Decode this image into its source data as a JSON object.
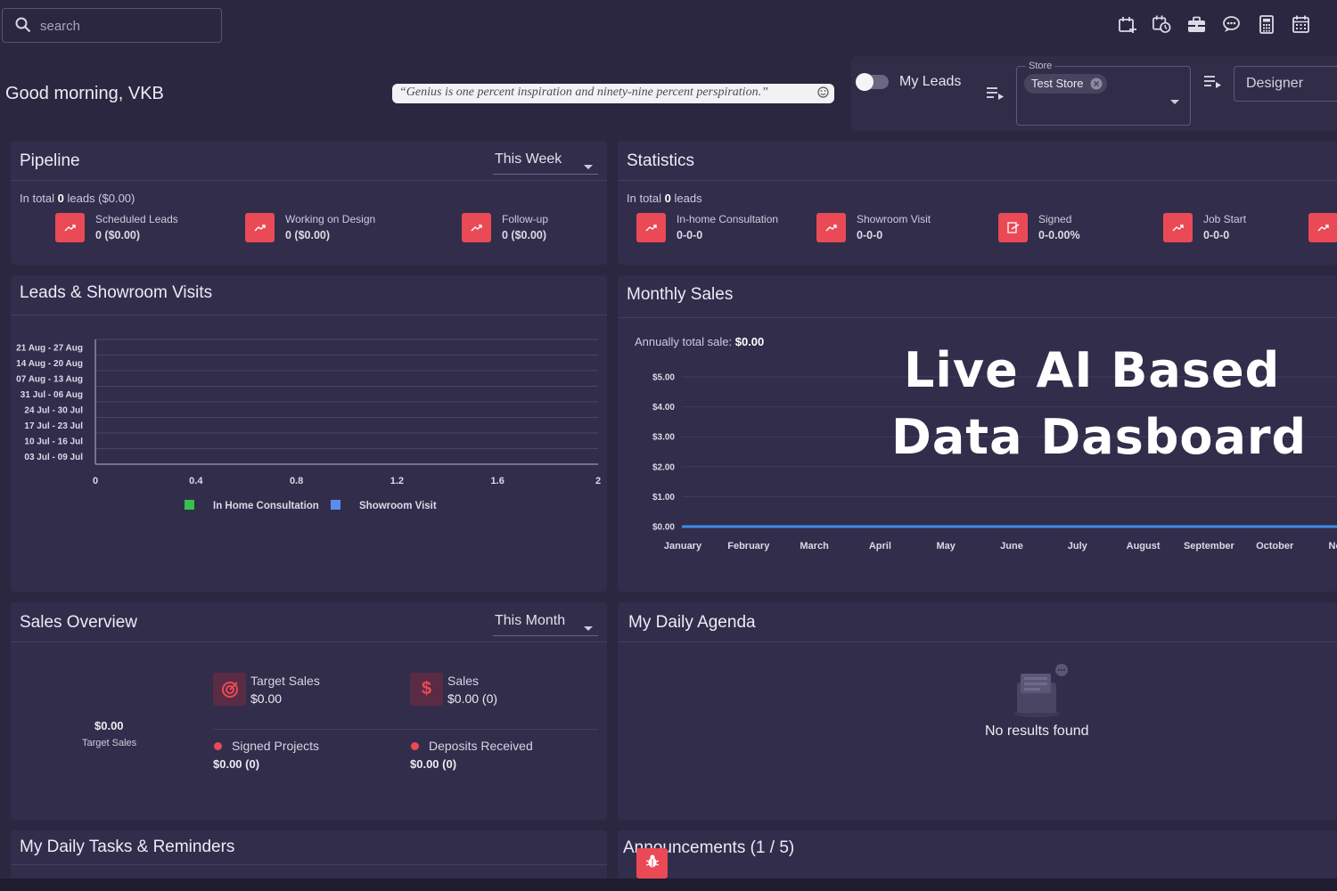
{
  "search": {
    "placeholder": "search"
  },
  "toolbar_icons": [
    "add-calendar-icon",
    "schedule-icon",
    "briefcase-icon",
    "chat-bubble-icon",
    "calculator-icon",
    "calendar-icon"
  ],
  "header": {
    "greeting": "Good morning, VKB",
    "quote": "“Genius is one percent inspiration and ninety-nine percent perspiration.”"
  },
  "filters": {
    "my_leads_label": "My Leads",
    "my_leads_on": false,
    "store_label": "Store",
    "store_chip": "Test Store",
    "role_value": "Designer"
  },
  "pipeline": {
    "title": "Pipeline",
    "period": "This Week",
    "total_prefix": "In total ",
    "total_count": "0",
    "total_suffix": " leads ($0.00)",
    "items": [
      {
        "label": "Scheduled Leads",
        "value": "0 ($0.00)"
      },
      {
        "label": "Working on Design",
        "value": "0 ($0.00)"
      },
      {
        "label": "Follow-up",
        "value": "0 ($0.00)"
      }
    ]
  },
  "statistics": {
    "title": "Statistics",
    "total_prefix": "In total ",
    "total_count": "0",
    "total_suffix": " leads",
    "items": [
      {
        "label": "In-home Consultation",
        "value": "0-0-0"
      },
      {
        "label": "Showroom Visit",
        "value": "0-0-0"
      },
      {
        "label": "Signed",
        "value": "0-0.00%"
      },
      {
        "label": "Job Start",
        "value": "0-0-0"
      }
    ]
  },
  "leads_visits": {
    "title": "Leads & Showroom Visits"
  },
  "monthly_sales": {
    "title": "Monthly Sales",
    "annual_label": "Annually total sale: ",
    "annual_value": "$0.00",
    "overlay_line1": "Live  AI Based",
    "overlay_line2": "Data  Dasboard"
  },
  "sales_overview": {
    "title": "Sales Overview",
    "period": "This Month",
    "center_value": "$0.00",
    "center_label": "Target Sales",
    "target_label": "Target Sales",
    "target_value": "$0.00",
    "sales_label": "Sales",
    "sales_value": "$0.00 (0)",
    "signed_label": "Signed Projects",
    "signed_value": "$0.00 (0)",
    "deposits_label": "Deposits Received",
    "deposits_value": "$0.00 (0)"
  },
  "agenda": {
    "title": "My Daily Agenda",
    "empty_text": "No results found"
  },
  "tasks": {
    "title": "My Daily Tasks & Reminders"
  },
  "announcements": {
    "title": "Announcements (1 / 5)"
  },
  "colors": {
    "background": "#2b2741",
    "panel": "#322d4b",
    "accent_red": "#e94a55",
    "series_green": "#35c24a",
    "series_blue": "#5b8def",
    "sales_line": "#3b8ee8"
  },
  "chart_data": [
    {
      "type": "bar",
      "orientation": "horizontal",
      "categories": [
        "21 Aug - 27 Aug",
        "14 Aug - 20 Aug",
        "07 Aug - 13 Aug",
        "31 Jul - 06 Aug",
        "24 Jul - 30 Jul",
        "17 Jul - 23 Jul",
        "10 Jul - 16 Jul",
        "03 Jul - 09 Jul"
      ],
      "series": [
        {
          "name": "In Home Consultation",
          "color": "#35c24a",
          "values": [
            0,
            0,
            0,
            0,
            0,
            0,
            0,
            0
          ]
        },
        {
          "name": "Showroom Visit",
          "color": "#5b8def",
          "values": [
            0,
            0,
            0,
            0,
            0,
            0,
            0,
            0
          ]
        }
      ],
      "xlim": [
        0,
        2
      ],
      "xticks": [
        "0",
        "0.4",
        "0.8",
        "1.2",
        "1.6",
        "2"
      ],
      "legend": "bottom",
      "grid": true
    },
    {
      "type": "line",
      "categories": [
        "January",
        "February",
        "March",
        "April",
        "May",
        "June",
        "July",
        "August",
        "September",
        "October",
        "Nove"
      ],
      "series": [
        {
          "values": [
            0,
            0,
            0,
            0,
            0,
            0,
            0,
            0,
            0,
            0,
            0
          ]
        }
      ],
      "ylim": [
        0,
        5
      ],
      "yticks": [
        "$0.00",
        "$1.00",
        "$2.00",
        "$3.00",
        "$4.00",
        "$5.00"
      ],
      "grid": true
    }
  ]
}
